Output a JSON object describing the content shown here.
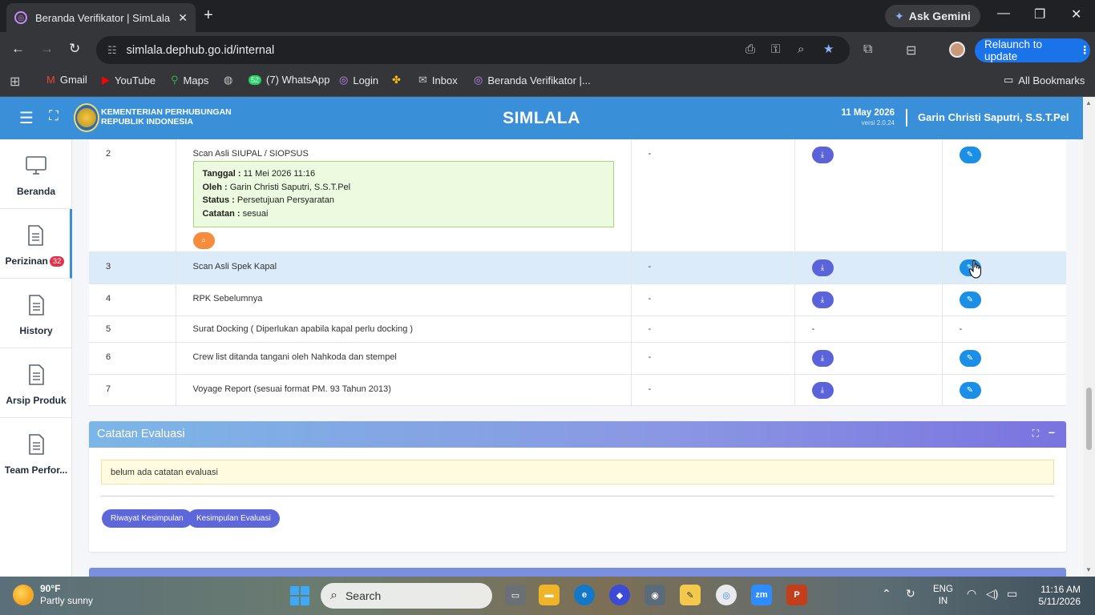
{
  "browser": {
    "tab_title": "Beranda Verifikator | SimLala",
    "new_tab": "+",
    "ask_gemini": "Ask Gemini",
    "url": "simlala.dephub.go.id/internal",
    "relaunch": "Relaunch to update",
    "bookmarks": [
      {
        "label": "Gmail",
        "icon": "gmail-icon",
        "color": "#ea4335"
      },
      {
        "label": "YouTube",
        "icon": "youtube-icon",
        "color": "#ff0000"
      },
      {
        "label": "Maps",
        "icon": "maps-icon",
        "color": "#34a853"
      },
      {
        "label": "",
        "icon": "globe-icon",
        "color": "#c4c7c5"
      },
      {
        "label": "(7) WhatsApp",
        "icon": "whatsapp-icon",
        "color": "#25d366",
        "badge": "52"
      },
      {
        "label": "Login",
        "icon": "simlala-icon",
        "color": "#c58af9"
      },
      {
        "label": "",
        "icon": "pinwheel-icon",
        "color": "#fbbc04"
      },
      {
        "label": "Inbox",
        "icon": "mail-icon",
        "color": "#c4c7c5"
      },
      {
        "label": "Beranda Verifikator |...",
        "icon": "simlala-icon",
        "color": "#c58af9"
      }
    ],
    "all_bookmarks": "All Bookmarks"
  },
  "header": {
    "ministry_line1": "KEMENTERIAN PERHUBUNGAN",
    "ministry_line2": "REPUBLIK INDONESIA",
    "app_title": "SIMLALA",
    "date": "11 May 2026",
    "version": "versi 2.0.24",
    "user": "Garin Christi Saputri, S.S.T.Pel"
  },
  "sidebar": {
    "items": [
      {
        "label": "Beranda",
        "icon": "monitor-icon"
      },
      {
        "label": "Perizinan",
        "icon": "document-icon",
        "badge": "32"
      },
      {
        "label": "History",
        "icon": "document-icon"
      },
      {
        "label": "Arsip Produk",
        "icon": "document-icon"
      },
      {
        "label": "Team Perfor...",
        "icon": "document-icon"
      }
    ]
  },
  "documents": {
    "rows": [
      {
        "no": "2",
        "name": "Scan Asli SIUPAL / SIOPSUS",
        "ket": "-",
        "has_download": true,
        "has_edit": true,
        "info": {
          "tanggal_label": "Tanggal :",
          "tanggal": "11 Mei 2026 11:16",
          "oleh_label": "Oleh :",
          "oleh": "Garin Christi Saputri, S.S.T.Pel",
          "status_label": "Status :",
          "status": "Persetujuan Persyaratan",
          "catatan_label": "Catatan :",
          "catatan": "sesuai"
        }
      },
      {
        "no": "3",
        "name": "Scan Asli Spek Kapal",
        "ket": "-",
        "has_download": true,
        "has_edit": true
      },
      {
        "no": "4",
        "name": "RPK Sebelumnya",
        "ket": "-",
        "has_download": true,
        "has_edit": true
      },
      {
        "no": "5",
        "name": "Surat Docking ( Diperlukan apabila kapal perlu docking )",
        "ket": "-",
        "download_text": "-",
        "edit_text": "-"
      },
      {
        "no": "6",
        "name": "Crew list ditanda tangani oleh Nahkoda dan stempel",
        "ket": "-",
        "has_download": true,
        "has_edit": true
      },
      {
        "no": "7",
        "name": "Voyage Report (sesuai format PM. 93 Tahun 2013)",
        "ket": "-",
        "has_download": true,
        "has_edit": true
      }
    ]
  },
  "evaluation": {
    "title": "Catatan Evaluasi",
    "note": "belum ada catatan evaluasi",
    "btn_history": "Riwayat Kesimpulan",
    "btn_conclusion": "Kesimpulan Evaluasi"
  },
  "taskbar": {
    "temp": "90°F",
    "weather": "Partly sunny",
    "search": "Search",
    "lang1": "ENG",
    "lang2": "IN",
    "time": "11:16 AM",
    "date": "5/11/2026"
  }
}
